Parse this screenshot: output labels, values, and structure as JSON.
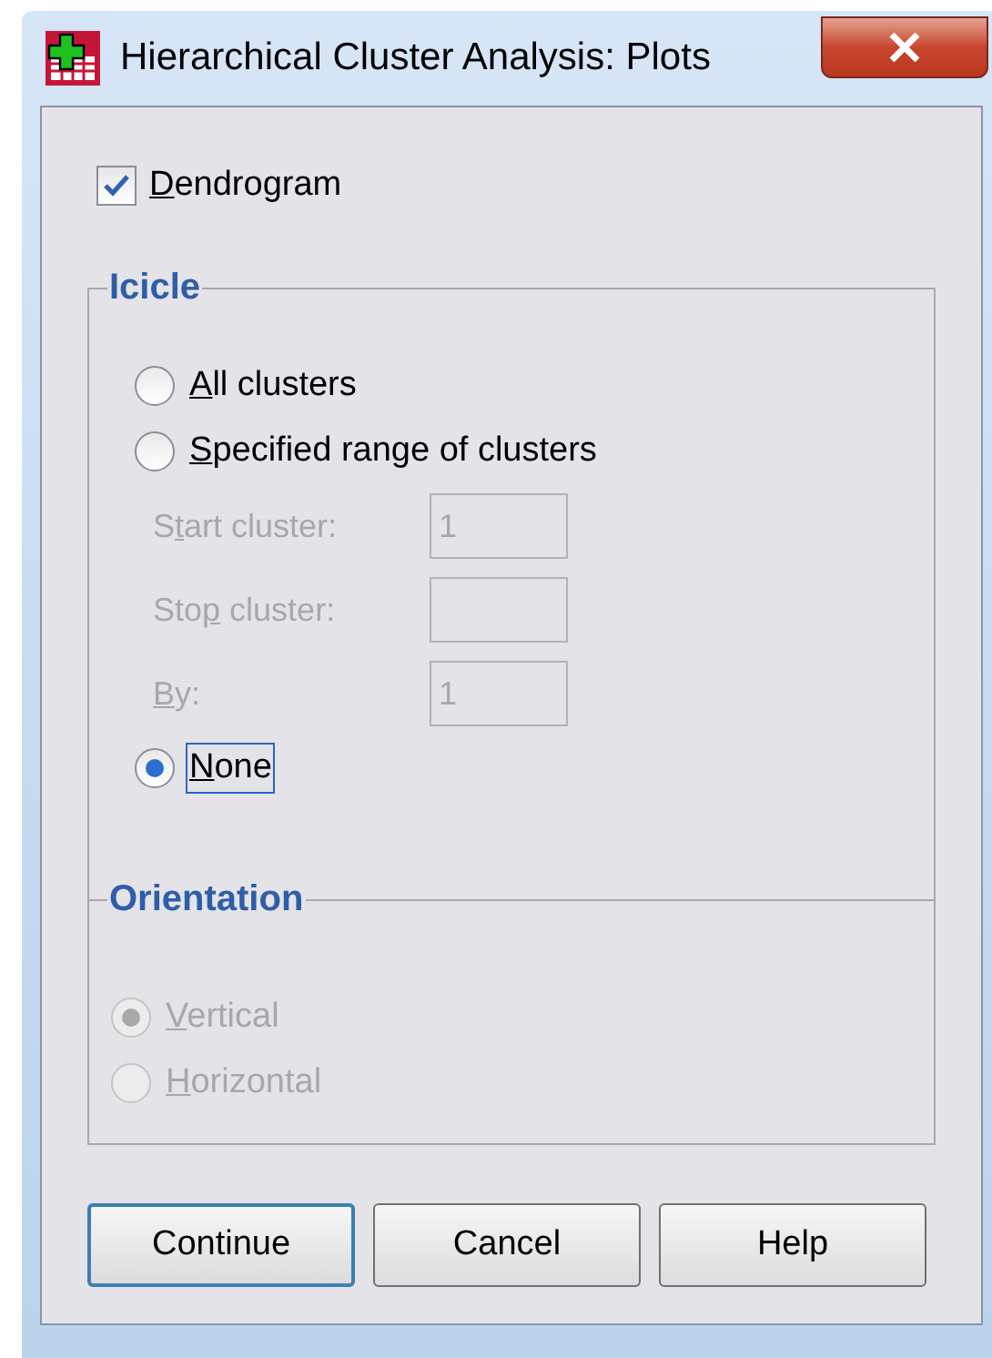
{
  "window": {
    "title": "Hierarchical Cluster Analysis: Plots"
  },
  "dendrogram": {
    "label": {
      "key": "D",
      "rest": "endrogram"
    },
    "checked": true
  },
  "icicle": {
    "title": "Icicle",
    "options": [
      {
        "kind": "radio",
        "label": {
          "key": "A",
          "rest": "ll clusters"
        },
        "selected": false,
        "disabled": false,
        "focused": false
      },
      {
        "kind": "radio",
        "label": {
          "key": "S",
          "rest": "pecified range of clusters"
        },
        "selected": false,
        "disabled": false,
        "focused": false
      },
      {
        "kind": "field",
        "label": {
          "pre": "S",
          "key": "t",
          "rest": "art cluster:"
        },
        "value": "1",
        "disabled": true
      },
      {
        "kind": "field",
        "label": {
          "pre": "Sto",
          "key": "p",
          "rest": " cluster:"
        },
        "disabled": true
      },
      {
        "kind": "field",
        "label": {
          "key": "B",
          "rest": "y:"
        },
        "value": "1",
        "disabled": true
      },
      {
        "kind": "radio",
        "label": {
          "key": "N",
          "rest": "one"
        },
        "selected": true,
        "disabled": false,
        "focused": true
      }
    ]
  },
  "orientation": {
    "title": "Orientation",
    "options": [
      {
        "kind": "radio",
        "label": {
          "key": "V",
          "rest": "ertical"
        },
        "selected": true,
        "disabled": true,
        "focused": false
      },
      {
        "kind": "radio",
        "label": {
          "key": "H",
          "rest": "orizontal"
        },
        "selected": false,
        "disabled": true,
        "focused": false
      }
    ]
  },
  "buttons": [
    {
      "label": "Continue",
      "default": true
    },
    {
      "label": "Cancel",
      "default": false
    },
    {
      "label": "Help",
      "default": false
    }
  ]
}
